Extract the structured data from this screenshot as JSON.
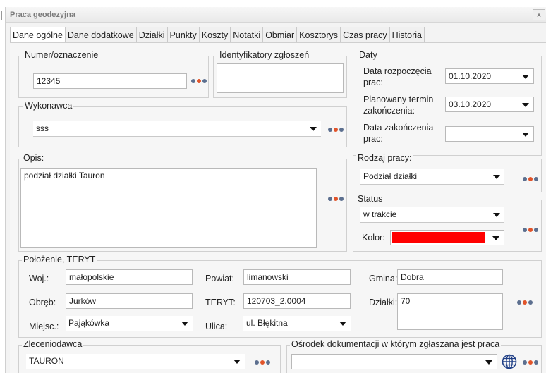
{
  "window": {
    "title": "Praca geodezyjna",
    "close_glyph": "x"
  },
  "tabs": [
    "Dane ogólne",
    "Dane dodatkowe",
    "Działki",
    "Punkty",
    "Koszty",
    "Notatki",
    "Obmiar",
    "Kosztorys",
    "Czas pracy",
    "Historia"
  ],
  "numer": {
    "legend": "Numer/oznaczenie",
    "value": "12345"
  },
  "identyfikatory": {
    "legend": "Identyfikatory zgłoszeń",
    "value": ""
  },
  "daty": {
    "legend": "Daty",
    "start_label_1": "Data rozpoczęcia",
    "start_label_2": "prac:",
    "start_value": "01.10.2020",
    "planned_label_1": "Planowany termin",
    "planned_label_2": "zakończenia:",
    "planned_value": "03.10.2020",
    "end_label_1": "Data zakończenia",
    "end_label_2": "prac:",
    "end_value": ""
  },
  "wykonawca": {
    "legend": "Wykonawca",
    "value": "sss"
  },
  "opis": {
    "legend": "Opis:",
    "value": "podział działki Tauron"
  },
  "rodzaj": {
    "legend": "Rodzaj pracy:",
    "value": "Podział działki"
  },
  "status": {
    "legend": "Status",
    "value": "w trakcie",
    "kolor_label": "Kolor:",
    "kolor_color": "#ff0000"
  },
  "polozenie": {
    "legend": "Położenie, TERYT",
    "woj_label": "Woj.:",
    "woj_value": "małopolskie",
    "powiat_label": "Powiat:",
    "powiat_value": "limanowski",
    "gmina_label": "Gmina:",
    "gmina_value": "Dobra",
    "obreb_label": "Obręb:",
    "obreb_value": "Jurków",
    "teryt_label": "TERYT:",
    "teryt_value": "120703_2.0004",
    "dzialki_label": "Działki:",
    "dzialki_value": "70",
    "miejsc_label": "Miejsc.:",
    "miejsc_value": "Pająkówka",
    "ulica_label": "Ulica:",
    "ulica_value": "ul.  Błękitna"
  },
  "zleceniodawca": {
    "legend": "Zleceniodawca",
    "value": "TAURON"
  },
  "osrodek": {
    "legend": "Ośrodek dokumentacji w którym zgłaszana jest praca",
    "value": ""
  },
  "icons": {
    "more": "more-dots-icon",
    "globe": "globe-icon",
    "dropdown": "chevron-down-icon"
  }
}
